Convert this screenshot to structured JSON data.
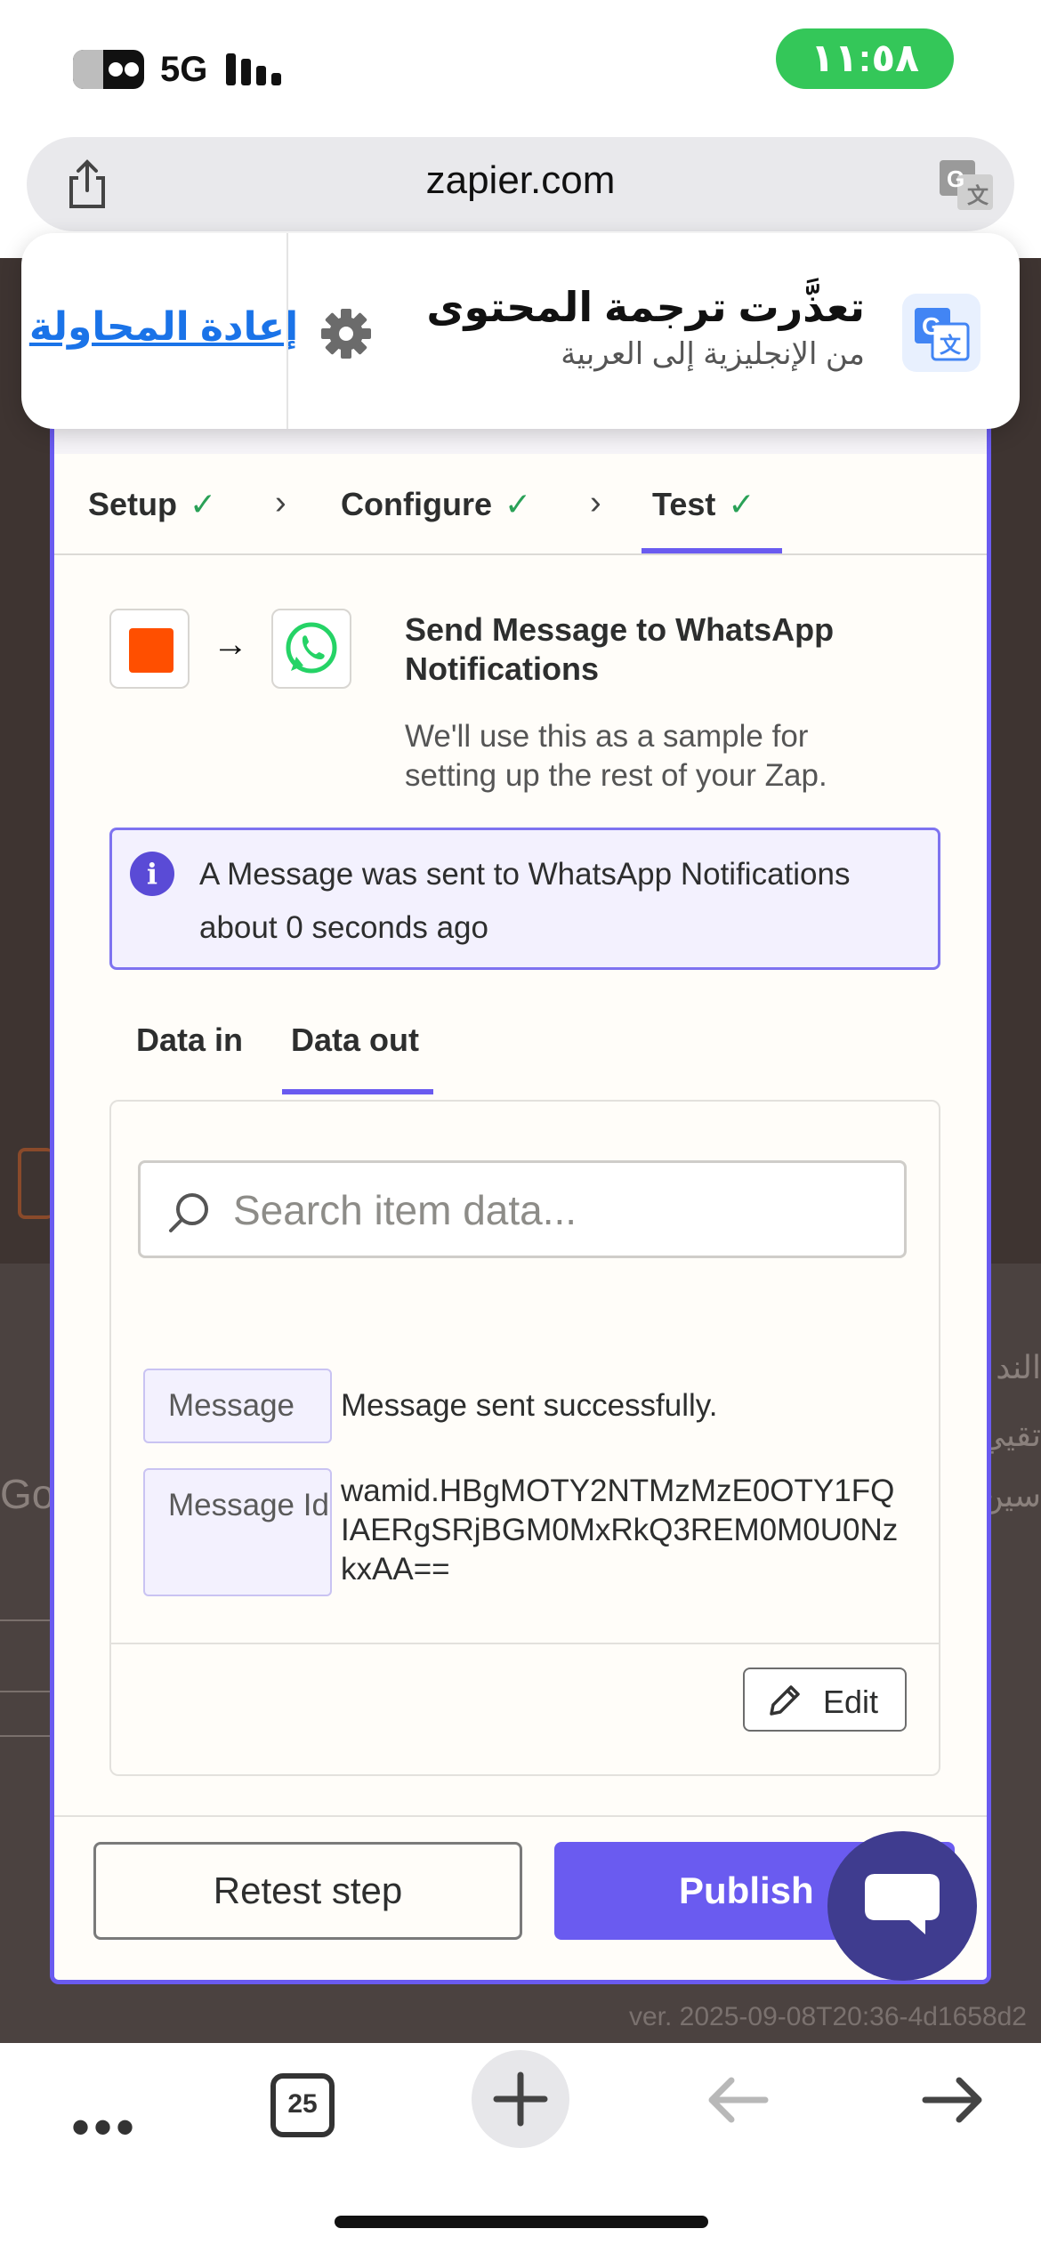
{
  "status_bar": {
    "network": "5G",
    "time": "١١:٥٨"
  },
  "browser": {
    "url": "zapier.com",
    "tab_count": "25",
    "icons": [
      "share-icon",
      "translate-icon",
      "more-icon",
      "tabs-icon",
      "plus-icon",
      "back-arrow-icon",
      "forward-arrow-icon"
    ]
  },
  "translation_banner": {
    "title": "تعذَّرت ترجمة المحتوى",
    "subtitle": "من الإنجليزية إلى العربية",
    "retry_label": "إعادة المحاولة"
  },
  "steps": [
    {
      "label": "Setup",
      "done": true
    },
    {
      "label": "Configure",
      "done": true
    },
    {
      "label": "Test",
      "done": true,
      "active": true
    }
  ],
  "step_check": "✓",
  "card": {
    "title": "Send Message to WhatsApp Notifications",
    "subtitle": "We'll use this as a sample for setting up the rest of your Zap."
  },
  "info": {
    "icon_text": "i",
    "message": "A Message was sent to WhatsApp Notifications about 0 seconds ago"
  },
  "tabs": [
    {
      "label": "Data in",
      "active": false
    },
    {
      "label": "Data out",
      "active": true
    }
  ],
  "search": {
    "placeholder": "Search item data..."
  },
  "data_out": [
    {
      "key": "Message",
      "value": "Message sent successfully."
    },
    {
      "key": "Message Id",
      "value": "wamid.HBgMOTY2NTMzMzE0OTY1FQIAERgSRjBGM0MxRkQ3REM0M0U0NzkxAA=="
    }
  ],
  "edit_label": "Edit",
  "footer": {
    "retest_label": "Retest step",
    "publish_label": "Publish"
  },
  "background": {
    "version": "ver. 2025-09-08T20:36-4d1658d2",
    "left_fragment": "Go",
    "right_fragments": [
      "الند",
      "تقيي",
      "سين"
    ]
  },
  "colors": {
    "accent": "#6a5bf0",
    "check_green": "#2aa157",
    "zapier_orange": "#ff4f00",
    "whatsapp_green": "#25d366",
    "time_pill": "#34c759",
    "retry_link": "#1a73e8"
  }
}
